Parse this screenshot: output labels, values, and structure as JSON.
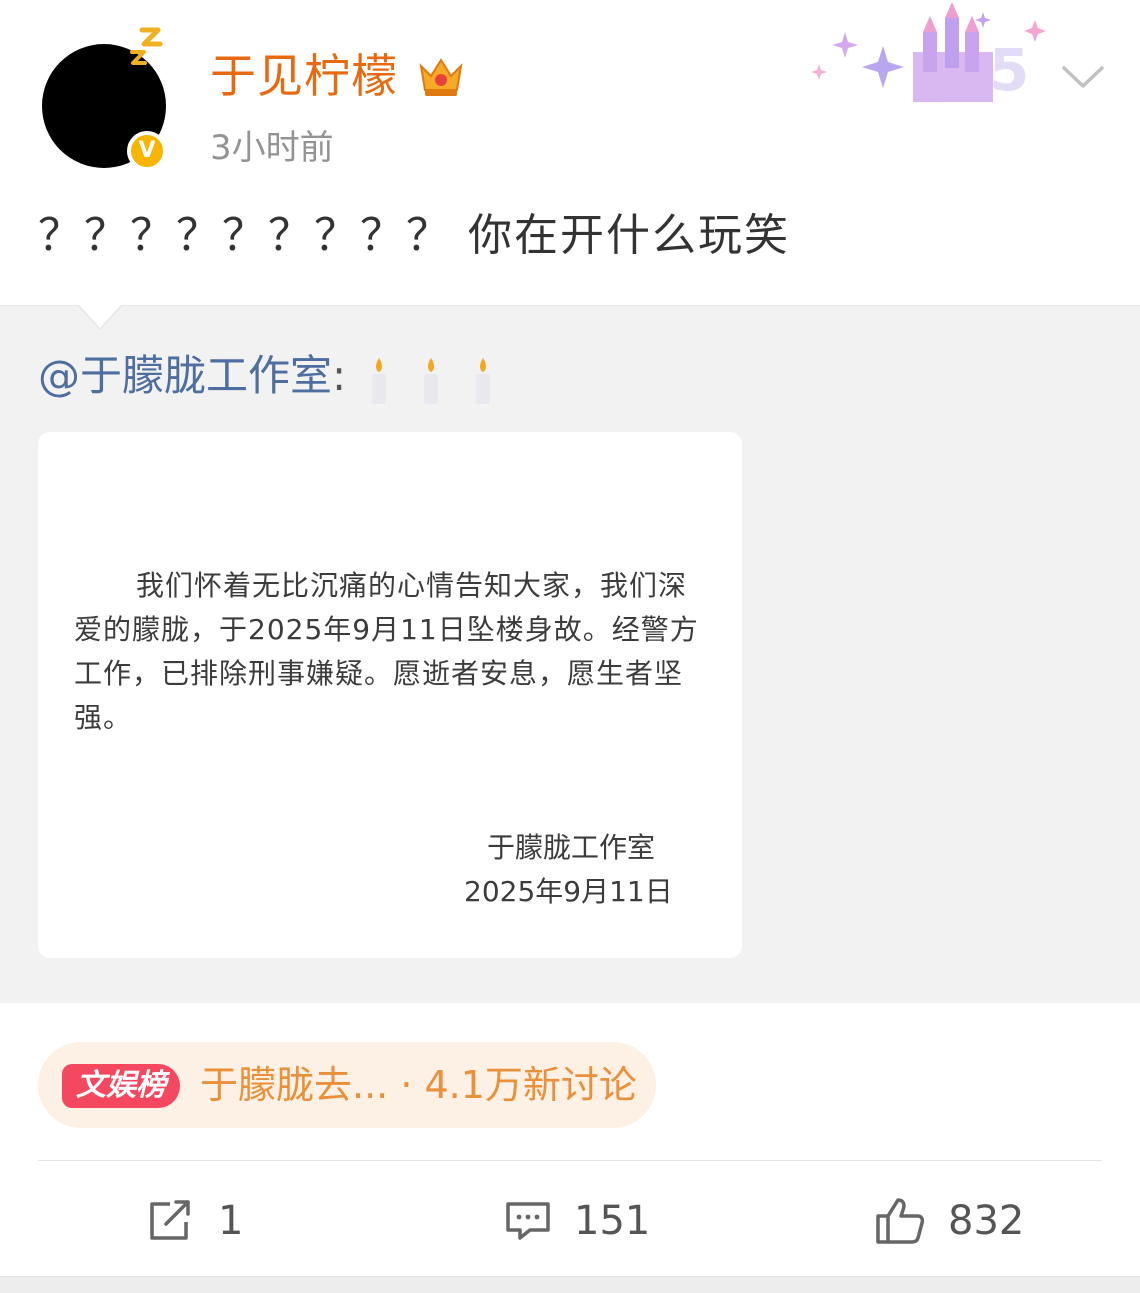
{
  "post": {
    "username": "于见柠檬",
    "timestamp": "3小时前",
    "text": "？？？？？？？？？ 你在开什么玩笑",
    "verified_mark": "V"
  },
  "repost": {
    "author": "@于朦胧工作室",
    "separator": ":",
    "candle_count": 3,
    "statement": {
      "body": "我们怀着无比沉痛的心情告知大家，我们深爱的朦胧，于2025年9月11日坠楼身故。经警方工作，已排除刑事嫌疑。愿逝者安息，愿生者坚强。",
      "signature": "于朦胧工作室",
      "date": "2025年9月11日"
    }
  },
  "topic": {
    "badge": "文娱榜",
    "text": "于朦胧去... · 4.1万新讨论"
  },
  "actions": {
    "repost_count": "1",
    "comment_count": "151",
    "like_count": "832"
  },
  "colors": {
    "username": "#e86a10",
    "repost_author": "#4f6ea0",
    "topic_text": "#e8903a",
    "topic_badge": "#f44860",
    "verified": "#f7b500"
  },
  "icons": [
    "zzz-icon",
    "verified-icon",
    "crown-icon",
    "sparkle-castle-icon",
    "chevron-down-icon",
    "candle-icon",
    "repost-icon",
    "comment-icon",
    "like-icon"
  ]
}
